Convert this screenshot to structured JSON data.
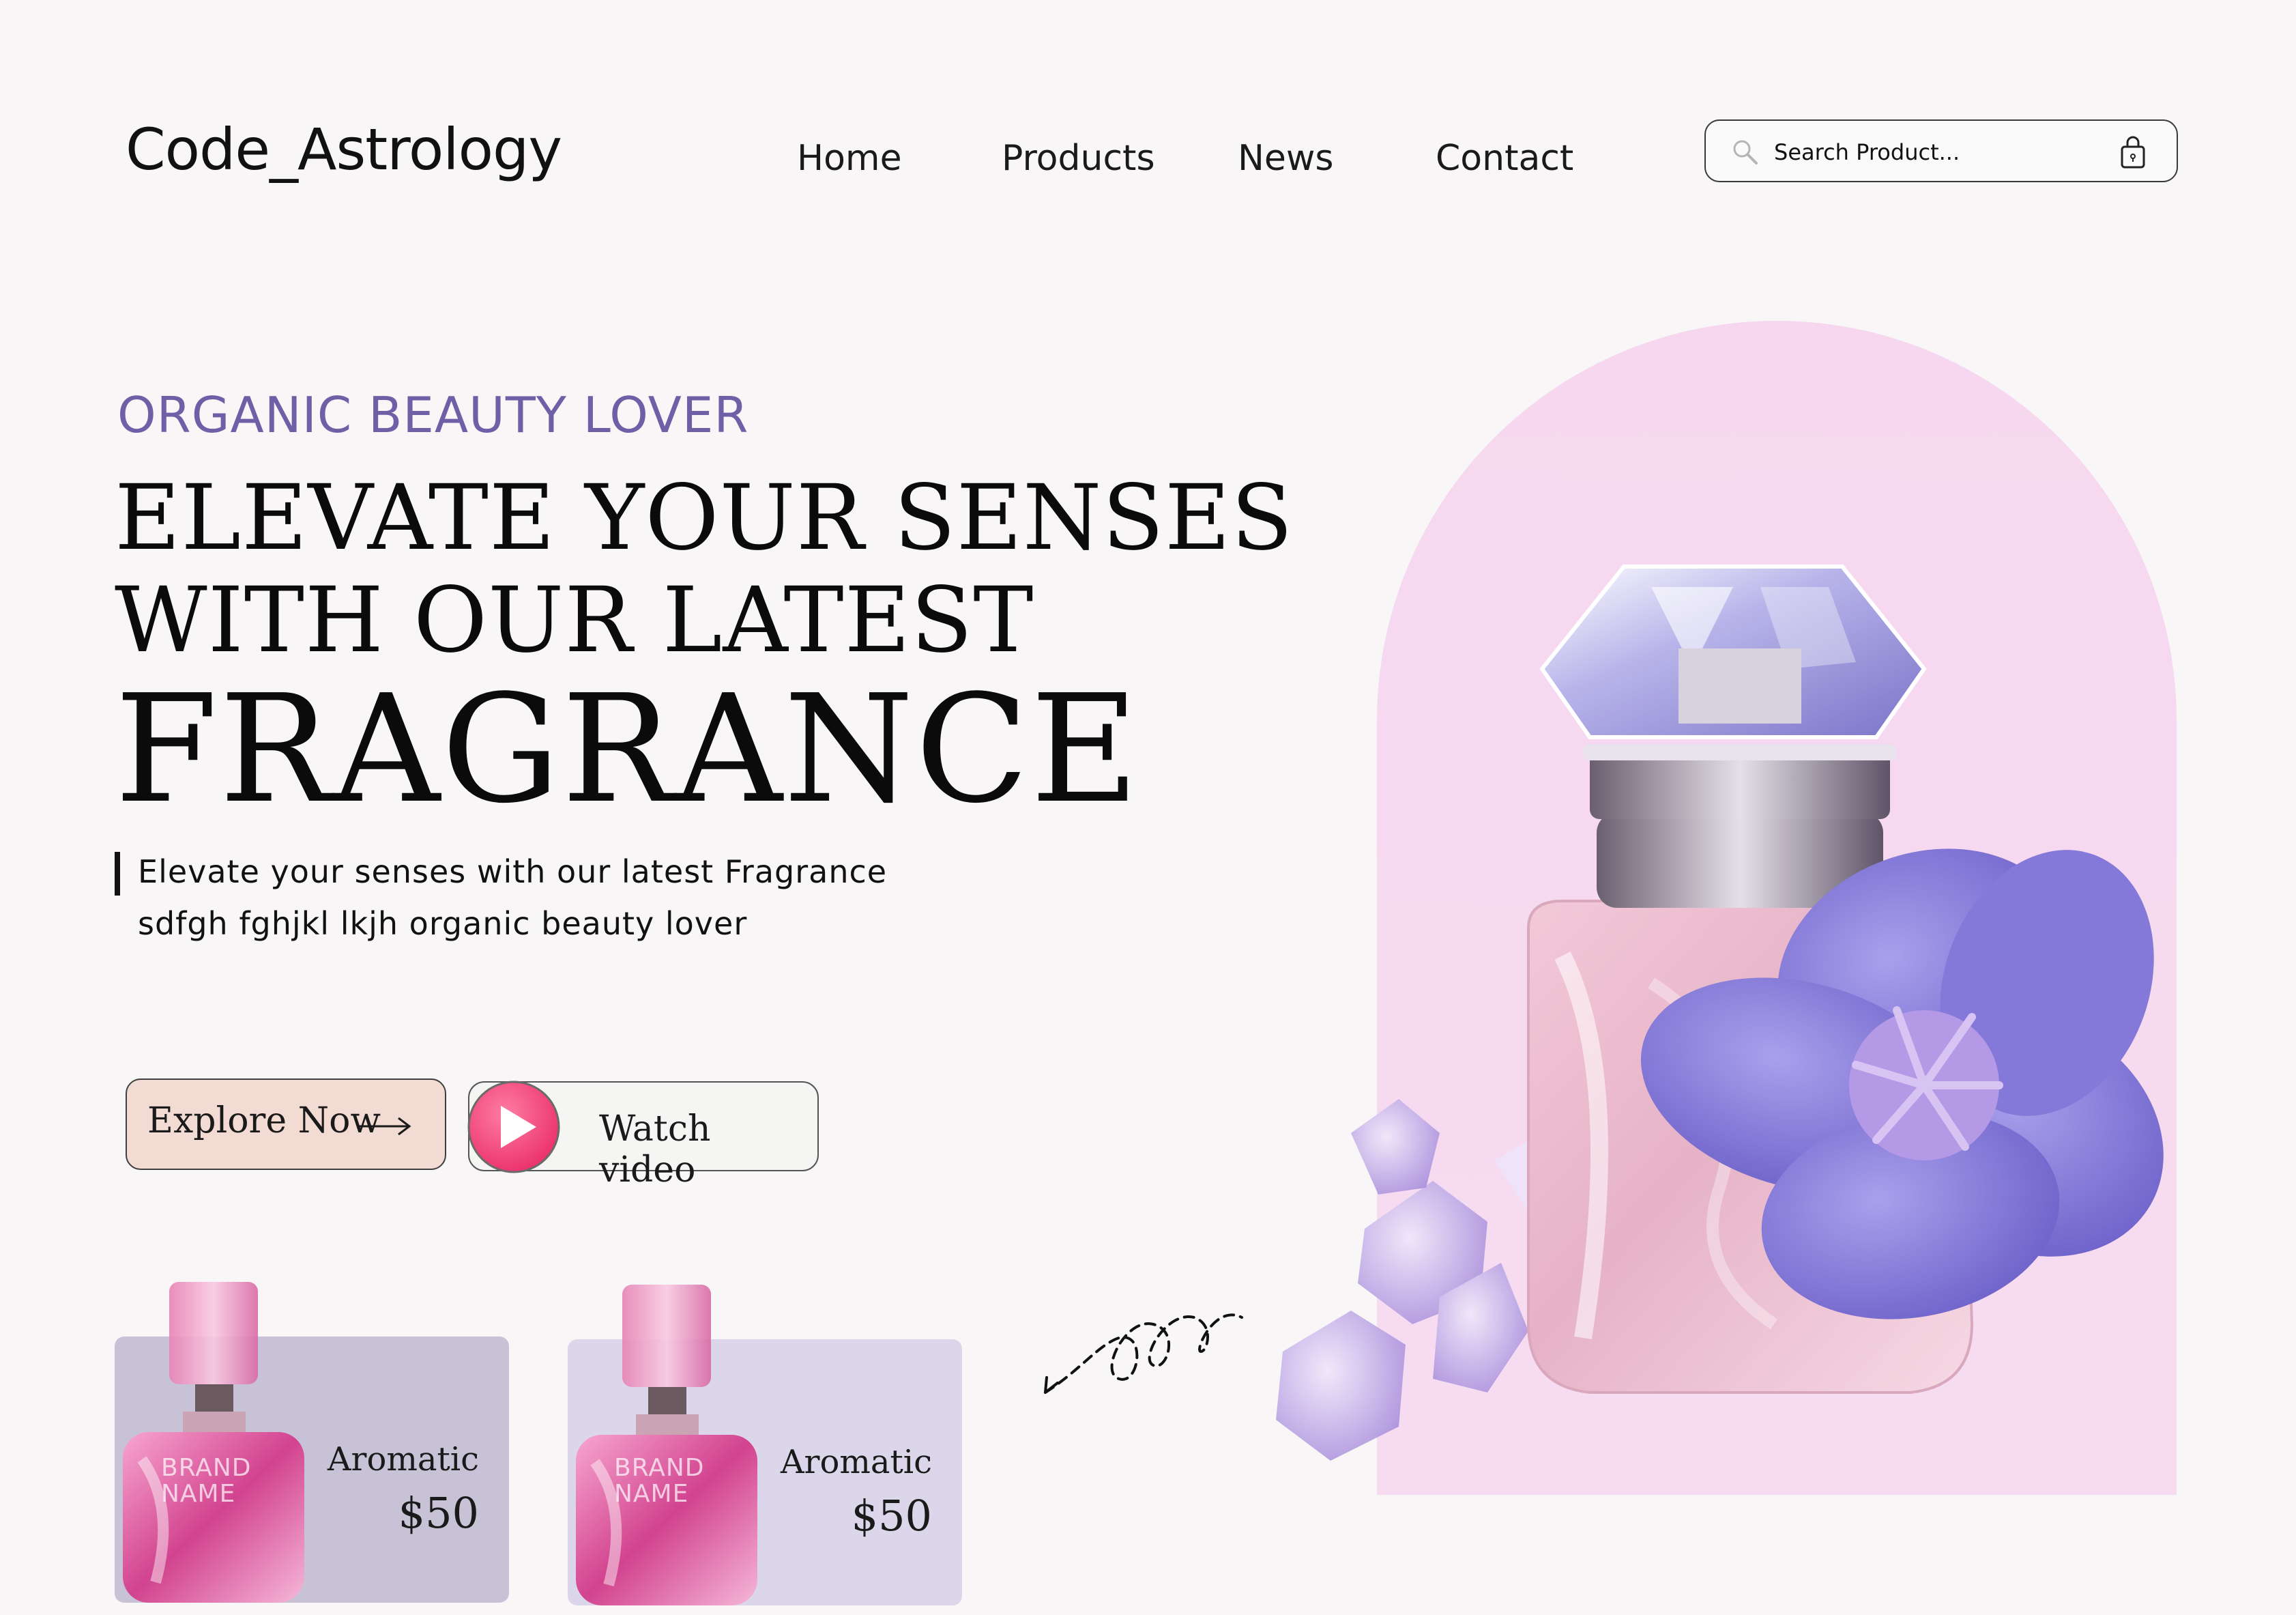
{
  "header": {
    "logo": "Code_Astrology",
    "nav": [
      "Home",
      "Products",
      "News",
      "Contact"
    ],
    "search_placeholder": "Search Product..."
  },
  "hero": {
    "eyebrow": "ORGANIC BEAUTY LOVER",
    "headline_line1": "ELEVATE YOUR SENSES",
    "headline_line2": "WITH OUR LATEST",
    "headline_line3": "FRAGRANCE",
    "sub_line1": "Elevate your senses with our latest Fragrance",
    "sub_line2": "sdfgh  fghjkl lkjh organic beauty lover",
    "explore_label": "Explore Now",
    "watch_label": "Watch video"
  },
  "products": [
    {
      "name": "Aromatic",
      "price": "$50",
      "brand_line1": "BRAND",
      "brand_line2": "NAME"
    },
    {
      "name": "Aromatic",
      "price": "$50",
      "brand_line1": "BRAND",
      "brand_line2": "NAME"
    }
  ],
  "colors": {
    "background": "#f8f6f7",
    "accent_purple": "#6f5fa6",
    "arch_pink": "#f6d7ef",
    "explore_bg": "#f2dbd3",
    "play_pink": "#f0457a",
    "card1_bg": "#c8c2d7",
    "card2_bg": "#dcd6ea"
  },
  "icons": [
    "search-icon",
    "shopping-bag-icon",
    "arrow-right-icon",
    "play-icon"
  ]
}
